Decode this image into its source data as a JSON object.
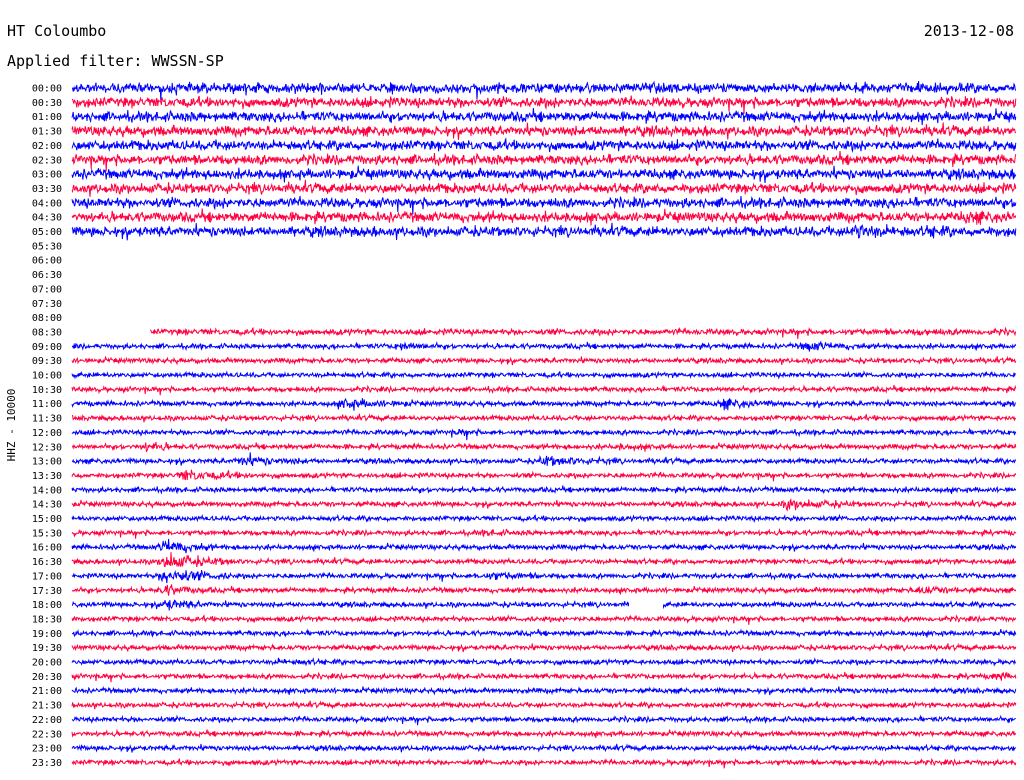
{
  "header": {
    "station": "HT Coloumbo",
    "date": "2013-12-08",
    "filter": "Applied filter: WWSSN-SP"
  },
  "chart_data": {
    "type": "line",
    "title": "HT Coloumbo",
    "subtitle": "Applied filter: WWSSN-SP",
    "ylabel": "HHZ - 10000",
    "colors": [
      "#0000ff",
      "#ff0040"
    ],
    "rows": [
      {
        "label": "00:00",
        "start": 0,
        "end": 1,
        "amp": 1.0,
        "gap": null,
        "events": []
      },
      {
        "label": "00:30",
        "start": 0,
        "end": 1,
        "amp": 1.0,
        "gap": null,
        "events": []
      },
      {
        "label": "01:00",
        "start": 0,
        "end": 1,
        "amp": 1.0,
        "gap": null,
        "events": []
      },
      {
        "label": "01:30",
        "start": 0,
        "end": 1,
        "amp": 1.0,
        "gap": null,
        "events": []
      },
      {
        "label": "02:00",
        "start": 0,
        "end": 1,
        "amp": 1.0,
        "gap": null,
        "events": []
      },
      {
        "label": "02:30",
        "start": 0,
        "end": 1,
        "amp": 1.0,
        "gap": null,
        "events": []
      },
      {
        "label": "03:00",
        "start": 0,
        "end": 1,
        "amp": 1.0,
        "gap": null,
        "events": []
      },
      {
        "label": "03:30",
        "start": 0,
        "end": 1,
        "amp": 1.0,
        "gap": null,
        "events": []
      },
      {
        "label": "04:00",
        "start": 0,
        "end": 1,
        "amp": 1.0,
        "gap": null,
        "events": []
      },
      {
        "label": "04:30",
        "start": 0,
        "end": 1,
        "amp": 1.0,
        "gap": null,
        "events": [
          {
            "pos": 0.95,
            "width": 0.05,
            "gain": 1.6
          }
        ]
      },
      {
        "label": "05:00",
        "start": 0,
        "end": 1,
        "amp": 1.0,
        "gap": null,
        "events": [
          {
            "pos": 0.83,
            "width": 0.06,
            "gain": 1.8
          },
          {
            "pos": 0.91,
            "width": 0.03,
            "gain": 1.5
          }
        ]
      },
      {
        "label": "05:30",
        "start": 0,
        "end": 0,
        "amp": 0,
        "gap": null,
        "events": []
      },
      {
        "label": "06:00",
        "start": 0,
        "end": 0,
        "amp": 0,
        "gap": null,
        "events": []
      },
      {
        "label": "06:30",
        "start": 0,
        "end": 0,
        "amp": 0,
        "gap": null,
        "events": []
      },
      {
        "label": "07:00",
        "start": 0,
        "end": 0,
        "amp": 0,
        "gap": null,
        "events": []
      },
      {
        "label": "07:30",
        "start": 0,
        "end": 0,
        "amp": 0,
        "gap": null,
        "events": []
      },
      {
        "label": "08:00",
        "start": 0,
        "end": 0,
        "amp": 0,
        "gap": null,
        "events": []
      },
      {
        "label": "08:30",
        "start": 0.083,
        "end": 1,
        "amp": 0.6,
        "gap": null,
        "events": [
          {
            "pos": 0.9,
            "width": 0.04,
            "gain": 1.4
          }
        ]
      },
      {
        "label": "09:00",
        "start": 0,
        "end": 1,
        "amp": 0.5,
        "gap": null,
        "events": [
          {
            "pos": 0.35,
            "width": 0.04,
            "gain": 2.2
          },
          {
            "pos": 0.78,
            "width": 0.06,
            "gain": 2.4
          }
        ]
      },
      {
        "label": "09:30",
        "start": 0,
        "end": 1,
        "amp": 0.5,
        "gap": null,
        "events": []
      },
      {
        "label": "10:00",
        "start": 0,
        "end": 1,
        "amp": 0.5,
        "gap": null,
        "events": []
      },
      {
        "label": "10:30",
        "start": 0,
        "end": 1,
        "amp": 0.5,
        "gap": null,
        "events": []
      },
      {
        "label": "11:00",
        "start": 0,
        "end": 1,
        "amp": 0.5,
        "gap": null,
        "events": [
          {
            "pos": 0.29,
            "width": 0.07,
            "gain": 2.6
          },
          {
            "pos": 0.69,
            "width": 0.06,
            "gain": 2.5
          }
        ]
      },
      {
        "label": "11:30",
        "start": 0,
        "end": 1,
        "amp": 0.5,
        "gap": null,
        "events": []
      },
      {
        "label": "12:00",
        "start": 0,
        "end": 1,
        "amp": 0.5,
        "gap": null,
        "events": [
          {
            "pos": 0.41,
            "width": 0.03,
            "gain": 1.6
          }
        ]
      },
      {
        "label": "12:30",
        "start": 0,
        "end": 1,
        "amp": 0.5,
        "gap": null,
        "events": [
          {
            "pos": 0.08,
            "width": 0.04,
            "gain": 2.4
          },
          {
            "pos": 0.58,
            "width": 0.05,
            "gain": 1.6
          }
        ]
      },
      {
        "label": "13:00",
        "start": 0,
        "end": 1,
        "amp": 0.5,
        "gap": null,
        "events": [
          {
            "pos": 0.18,
            "width": 0.08,
            "gain": 2.4
          },
          {
            "pos": 0.5,
            "width": 0.08,
            "gain": 2.4
          }
        ]
      },
      {
        "label": "13:30",
        "start": 0,
        "end": 1,
        "amp": 0.5,
        "gap": null,
        "events": [
          {
            "pos": 0.12,
            "width": 0.08,
            "gain": 2.6
          }
        ]
      },
      {
        "label": "14:00",
        "start": 0,
        "end": 1,
        "amp": 0.5,
        "gap": null,
        "events": []
      },
      {
        "label": "14:30",
        "start": 0,
        "end": 1,
        "amp": 0.5,
        "gap": null,
        "events": [
          {
            "pos": 0.76,
            "width": 0.07,
            "gain": 2.6
          }
        ]
      },
      {
        "label": "15:00",
        "start": 0,
        "end": 1,
        "amp": 0.5,
        "gap": null,
        "events": []
      },
      {
        "label": "15:30",
        "start": 0,
        "end": 1,
        "amp": 0.5,
        "gap": null,
        "events": [
          {
            "pos": 0.44,
            "width": 0.05,
            "gain": 1.5
          }
        ]
      },
      {
        "label": "16:00",
        "start": 0,
        "end": 1,
        "amp": 0.5,
        "gap": null,
        "events": [
          {
            "pos": 0.1,
            "width": 0.05,
            "gain": 3.6
          }
        ]
      },
      {
        "label": "16:30",
        "start": 0,
        "end": 1,
        "amp": 0.5,
        "gap": null,
        "events": [
          {
            "pos": 0.1,
            "width": 0.07,
            "gain": 4.0
          }
        ]
      },
      {
        "label": "17:00",
        "start": 0,
        "end": 1,
        "amp": 0.5,
        "gap": null,
        "events": [
          {
            "pos": 0.1,
            "width": 0.07,
            "gain": 4.0
          },
          {
            "pos": 0.44,
            "width": 0.07,
            "gain": 2.0
          }
        ]
      },
      {
        "label": "17:30",
        "start": 0,
        "end": 1,
        "amp": 0.5,
        "gap": null,
        "events": [
          {
            "pos": 0.1,
            "width": 0.05,
            "gain": 2.6
          },
          {
            "pos": 0.9,
            "width": 0.06,
            "gain": 2.2
          }
        ]
      },
      {
        "label": "18:00",
        "start": 0,
        "end": 1,
        "amp": 0.5,
        "gap": [
          0.59,
          0.626
        ],
        "events": [
          {
            "pos": 0.1,
            "width": 0.05,
            "gain": 2.6
          }
        ]
      },
      {
        "label": "18:30",
        "start": 0,
        "end": 1,
        "amp": 0.5,
        "gap": null,
        "events": []
      },
      {
        "label": "19:00",
        "start": 0,
        "end": 1,
        "amp": 0.5,
        "gap": null,
        "events": []
      },
      {
        "label": "19:30",
        "start": 0,
        "end": 1,
        "amp": 0.5,
        "gap": null,
        "events": []
      },
      {
        "label": "20:00",
        "start": 0,
        "end": 1,
        "amp": 0.5,
        "gap": null,
        "events": [
          {
            "pos": 0.22,
            "width": 0.06,
            "gain": 1.5
          }
        ]
      },
      {
        "label": "20:30",
        "start": 0,
        "end": 1,
        "amp": 0.5,
        "gap": null,
        "events": [
          {
            "pos": 0.98,
            "width": 0.03,
            "gain": 2.0
          }
        ]
      },
      {
        "label": "21:00",
        "start": 0,
        "end": 1,
        "amp": 0.5,
        "gap": null,
        "events": []
      },
      {
        "label": "21:30",
        "start": 0,
        "end": 1,
        "amp": 0.5,
        "gap": null,
        "events": []
      },
      {
        "label": "22:00",
        "start": 0,
        "end": 1,
        "amp": 0.5,
        "gap": null,
        "events": []
      },
      {
        "label": "22:30",
        "start": 0,
        "end": 1,
        "amp": 0.5,
        "gap": null,
        "events": []
      },
      {
        "label": "23:00",
        "start": 0,
        "end": 1,
        "amp": 0.5,
        "gap": null,
        "events": []
      },
      {
        "label": "23:30",
        "start": 0,
        "end": 1,
        "amp": 0.5,
        "gap": null,
        "events": []
      }
    ]
  }
}
